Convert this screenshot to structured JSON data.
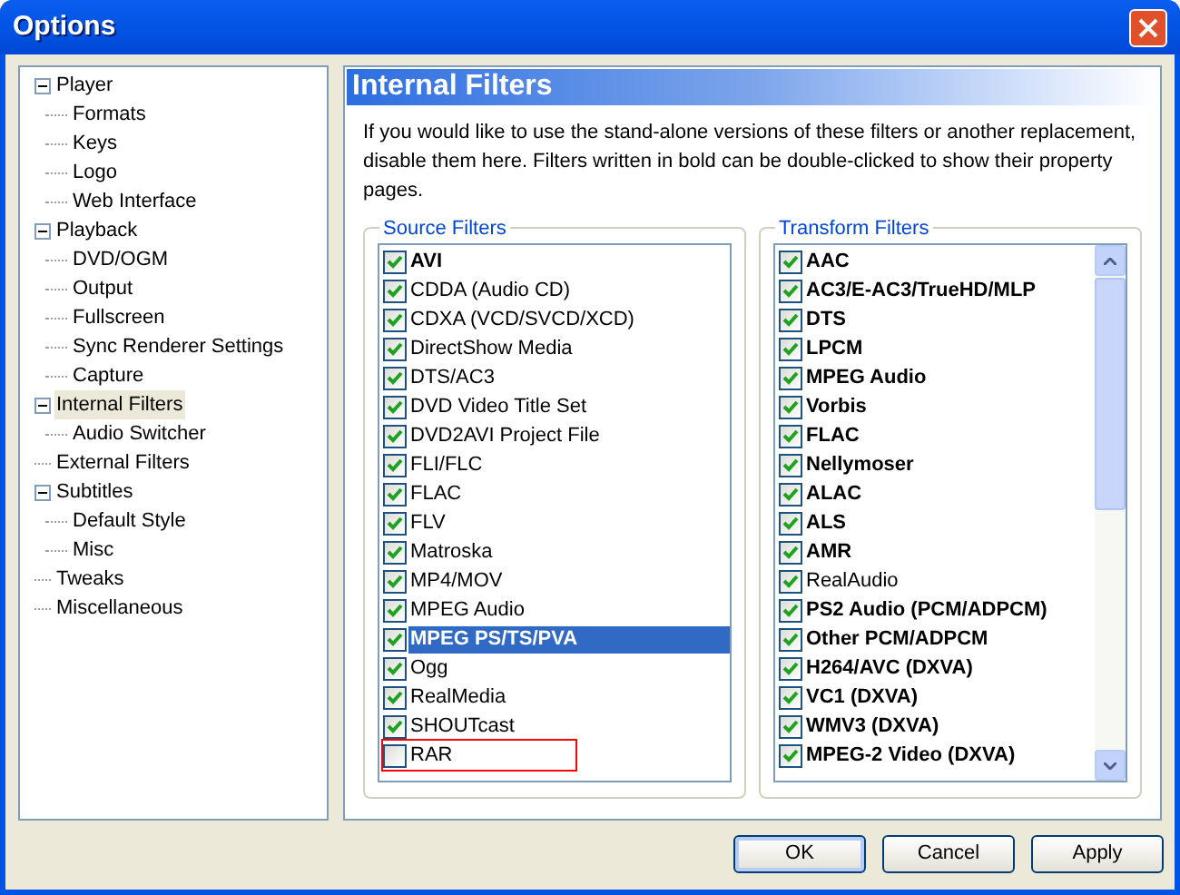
{
  "window": {
    "title": "Options"
  },
  "tree": [
    {
      "label": "Player",
      "expanded": true,
      "selected": false,
      "children": [
        {
          "label": "Formats",
          "selected": false
        },
        {
          "label": "Keys",
          "selected": false
        },
        {
          "label": "Logo",
          "selected": false
        },
        {
          "label": "Web Interface",
          "selected": false
        }
      ]
    },
    {
      "label": "Playback",
      "expanded": true,
      "selected": false,
      "children": [
        {
          "label": "DVD/OGM",
          "selected": false
        },
        {
          "label": "Output",
          "selected": false
        },
        {
          "label": "Fullscreen",
          "selected": false
        },
        {
          "label": "Sync Renderer Settings",
          "selected": false
        },
        {
          "label": "Capture",
          "selected": false
        }
      ]
    },
    {
      "label": "Internal Filters",
      "expanded": true,
      "selected": true,
      "children": [
        {
          "label": "Audio Switcher",
          "selected": false
        }
      ]
    },
    {
      "label": "External Filters",
      "selected": false
    },
    {
      "label": "Subtitles",
      "expanded": true,
      "selected": false,
      "children": [
        {
          "label": "Default Style",
          "selected": false
        },
        {
          "label": "Misc",
          "selected": false
        }
      ]
    },
    {
      "label": "Tweaks",
      "selected": false
    },
    {
      "label": "Miscellaneous",
      "selected": false
    }
  ],
  "page": {
    "title": "Internal Filters",
    "description": "If you would like to use the stand-alone versions of these filters or another replacement, disable them here. Filters written in bold can be double-clicked to show their property pages."
  },
  "groups": [
    {
      "title": "Source Filters",
      "items": [
        {
          "label": "AVI",
          "checked": true,
          "bold": true,
          "selected": false,
          "marked": false
        },
        {
          "label": "CDDA (Audio CD)",
          "checked": true,
          "bold": false,
          "selected": false,
          "marked": false
        },
        {
          "label": "CDXA (VCD/SVCD/XCD)",
          "checked": true,
          "bold": false,
          "selected": false,
          "marked": false
        },
        {
          "label": "DirectShow Media",
          "checked": true,
          "bold": false,
          "selected": false,
          "marked": false
        },
        {
          "label": "DTS/AC3",
          "checked": true,
          "bold": false,
          "selected": false,
          "marked": false
        },
        {
          "label": "DVD Video Title Set",
          "checked": true,
          "bold": false,
          "selected": false,
          "marked": false
        },
        {
          "label": "DVD2AVI Project File",
          "checked": true,
          "bold": false,
          "selected": false,
          "marked": false
        },
        {
          "label": "FLI/FLC",
          "checked": true,
          "bold": false,
          "selected": false,
          "marked": false
        },
        {
          "label": "FLAC",
          "checked": true,
          "bold": false,
          "selected": false,
          "marked": false
        },
        {
          "label": "FLV",
          "checked": true,
          "bold": false,
          "selected": false,
          "marked": false
        },
        {
          "label": "Matroska",
          "checked": true,
          "bold": false,
          "selected": false,
          "marked": false
        },
        {
          "label": "MP4/MOV",
          "checked": true,
          "bold": false,
          "selected": false,
          "marked": false
        },
        {
          "label": "MPEG Audio",
          "checked": true,
          "bold": false,
          "selected": false,
          "marked": false
        },
        {
          "label": "MPEG PS/TS/PVA",
          "checked": true,
          "bold": true,
          "selected": true,
          "marked": false
        },
        {
          "label": "Ogg",
          "checked": true,
          "bold": false,
          "selected": false,
          "marked": false
        },
        {
          "label": "RealMedia",
          "checked": true,
          "bold": false,
          "selected": false,
          "marked": false
        },
        {
          "label": "SHOUTcast",
          "checked": true,
          "bold": false,
          "selected": false,
          "marked": false
        },
        {
          "label": "RAR",
          "checked": false,
          "bold": false,
          "selected": false,
          "marked": true
        }
      ]
    },
    {
      "title": "Transform Filters",
      "scrollbar": true,
      "items": [
        {
          "label": "AAC",
          "checked": true,
          "bold": true,
          "selected": false,
          "marked": false
        },
        {
          "label": "AC3/E-AC3/TrueHD/MLP",
          "checked": true,
          "bold": true,
          "selected": false,
          "marked": false
        },
        {
          "label": "DTS",
          "checked": true,
          "bold": true,
          "selected": false,
          "marked": false
        },
        {
          "label": "LPCM",
          "checked": true,
          "bold": true,
          "selected": false,
          "marked": false
        },
        {
          "label": "MPEG Audio",
          "checked": true,
          "bold": true,
          "selected": false,
          "marked": false
        },
        {
          "label": "Vorbis",
          "checked": true,
          "bold": true,
          "selected": false,
          "marked": false
        },
        {
          "label": "FLAC",
          "checked": true,
          "bold": true,
          "selected": false,
          "marked": false
        },
        {
          "label": "Nellymoser",
          "checked": true,
          "bold": true,
          "selected": false,
          "marked": false
        },
        {
          "label": "ALAC",
          "checked": true,
          "bold": true,
          "selected": false,
          "marked": false
        },
        {
          "label": "ALS",
          "checked": true,
          "bold": true,
          "selected": false,
          "marked": false
        },
        {
          "label": "AMR",
          "checked": true,
          "bold": true,
          "selected": false,
          "marked": false
        },
        {
          "label": "RealAudio",
          "checked": true,
          "bold": false,
          "selected": false,
          "marked": false
        },
        {
          "label": "PS2 Audio (PCM/ADPCM)",
          "checked": true,
          "bold": true,
          "selected": false,
          "marked": false
        },
        {
          "label": "Other PCM/ADPCM",
          "checked": true,
          "bold": true,
          "selected": false,
          "marked": false
        },
        {
          "label": "H264/AVC (DXVA)",
          "checked": true,
          "bold": true,
          "selected": false,
          "marked": false
        },
        {
          "label": "VC1 (DXVA)",
          "checked": true,
          "bold": true,
          "selected": false,
          "marked": false
        },
        {
          "label": "WMV3 (DXVA)",
          "checked": true,
          "bold": true,
          "selected": false,
          "marked": false
        },
        {
          "label": "MPEG-2 Video (DXVA)",
          "checked": true,
          "bold": true,
          "selected": false,
          "marked": false
        }
      ]
    }
  ],
  "buttons": [
    {
      "label": "OK",
      "default": true
    },
    {
      "label": "Cancel",
      "default": false
    },
    {
      "label": "Apply",
      "default": false
    }
  ]
}
